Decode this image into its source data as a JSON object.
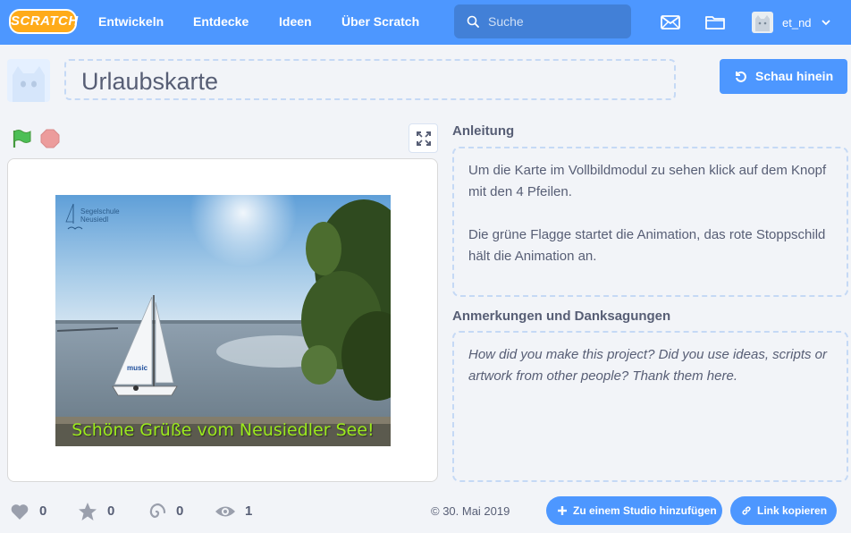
{
  "nav": {
    "logo_text": "SCRATCH",
    "links": [
      "Entwickeln",
      "Entdecke",
      "Ideen",
      "Über Scratch"
    ],
    "search_placeholder": "Suche",
    "username": "et_nd"
  },
  "project": {
    "title": "Urlaubskarte",
    "see_inside_label": "Schau hinein"
  },
  "stage": {
    "brand_line1": "Segelschule",
    "brand_line2": "Neusiedl",
    "sail_text": "music",
    "caption": "Schöne Grüße vom Neusiedler See!"
  },
  "instructions": {
    "heading": "Anleitung",
    "paragraph1": "Um die Karte im Vollbildmodul zu sehen klick auf dem Knopf mit den 4 Pfeilen.",
    "paragraph2": "Die grüne Flagge startet die Animation, das rote Stoppschild hält die Animation an."
  },
  "notes": {
    "heading": "Anmerkungen und Danksagungen",
    "placeholder": "How did you make this project? Did you use ideas, scripts or artwork from other people? Thank them here."
  },
  "stats": {
    "loves": "0",
    "favorites": "0",
    "remixes": "0",
    "views": "1",
    "date": "© 30. Mai 2019"
  },
  "actions": {
    "add_to_studio": "Zu einem Studio hinzufügen",
    "copy_link": "Link kopieren"
  },
  "colors": {
    "nav_blue": "#4d97ff",
    "logo_orange": "#ffab19",
    "flag_green": "#4cbf56",
    "stop_red": "#ec9c9c",
    "caption_green": "#9bea1d"
  }
}
